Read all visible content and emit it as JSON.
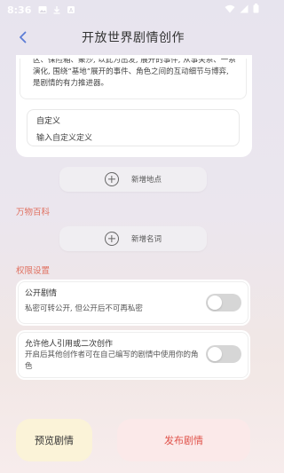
{
  "status_bar": {
    "time": "8:36",
    "icons": [
      "gallery-icon",
      "download-icon",
      "android-icon",
      "wifi-icon",
      "signal-icon",
      "battery-icon"
    ]
  },
  "header": {
    "title": "开放世界剧情创作",
    "back_icon": "chevron-left-icon"
  },
  "setting_card": {
    "clipped_text": "区、保险箱、聚沙, 以此为出发, 展开的事件, 从事关系、一系演化, 围绕“基地”展开的事件、角色之间的互动细节与博弈, 是剧情的有力推进器。",
    "custom": {
      "title": "自定义",
      "desc": "输入自定义定义"
    }
  },
  "buttons": {
    "add_location": "新增地点",
    "add_term": "新增名词",
    "preview": "预览剧情",
    "publish": "发布剧情"
  },
  "sections": {
    "encyclopedia": "万物百科",
    "permissions": "权限设置"
  },
  "permissions": [
    {
      "title": "公开剧情",
      "desc": "私密可转公开, 但公开后不可再私密",
      "enabled": false
    },
    {
      "title": "允许他人引用或二次创作",
      "desc": "开启后其他创作者可在自己编写的剧情中使用你的角色",
      "enabled": false
    }
  ],
  "colors": {
    "accent": "#e07060",
    "publish_text": "#e0524a",
    "preview_bg": "#fbf3d8",
    "publish_bg": "#fbe9e9",
    "back_icon": "#5b7bd5"
  }
}
